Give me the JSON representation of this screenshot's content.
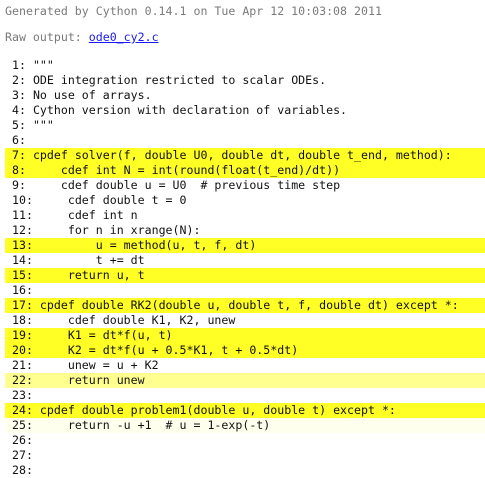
{
  "header": {
    "generated_text": "Generated by Cython 0.14.1 on Tue Apr 12 10:03:08 2011",
    "raw_output_label": "Raw output: ",
    "raw_output_link": "ode0_cy2.c"
  },
  "colors": {
    "full": "#ffff26",
    "medium": "#ffff90",
    "light": "#ffffee",
    "none": "#ffffff"
  },
  "lines": [
    {
      "text": "1: \"\"\"",
      "level": "none"
    },
    {
      "text": "2: ODE integration restricted to scalar ODEs.",
      "level": "none"
    },
    {
      "text": "3: No use of arrays.",
      "level": "none"
    },
    {
      "text": "4: Cython version with declaration of variables.",
      "level": "none"
    },
    {
      "text": "5: \"\"\"",
      "level": "none"
    },
    {
      "text": "6:",
      "level": "none"
    },
    {
      "text": "7: cpdef solver(f, double U0, double dt, double t_end, method):",
      "level": "full"
    },
    {
      "text": "8:     cdef int N = int(round(float(t_end)/dt))",
      "level": "full"
    },
    {
      "text": "9:     cdef double u = U0  # previous time step",
      "level": "none"
    },
    {
      "text": "10:     cdef double t = 0",
      "level": "none"
    },
    {
      "text": "11:     cdef int n",
      "level": "none"
    },
    {
      "text": "12:     for n in xrange(N):",
      "level": "none"
    },
    {
      "text": "13:         u = method(u, t, f, dt)",
      "level": "full"
    },
    {
      "text": "14:         t += dt",
      "level": "none"
    },
    {
      "text": "15:     return u, t",
      "level": "full"
    },
    {
      "text": "16:",
      "level": "none"
    },
    {
      "text": "17: cpdef double RK2(double u, double t, f, double dt) except *:",
      "level": "full"
    },
    {
      "text": "18:     cdef double K1, K2, unew",
      "level": "none"
    },
    {
      "text": "19:     K1 = dt*f(u, t)",
      "level": "full"
    },
    {
      "text": "20:     K2 = dt*f(u + 0.5*K1, t + 0.5*dt)",
      "level": "full"
    },
    {
      "text": "21:     unew = u + K2",
      "level": "none"
    },
    {
      "text": "22:     return unew",
      "level": "medium"
    },
    {
      "text": "23:",
      "level": "none"
    },
    {
      "text": "24: cpdef double problem1(double u, double t) except *:",
      "level": "full"
    },
    {
      "text": "25:     return -u +1  # u = 1-exp(-t)",
      "level": "light"
    },
    {
      "text": "26:",
      "level": "none"
    },
    {
      "text": "27:",
      "level": "none"
    },
    {
      "text": "28:",
      "level": "none"
    }
  ]
}
